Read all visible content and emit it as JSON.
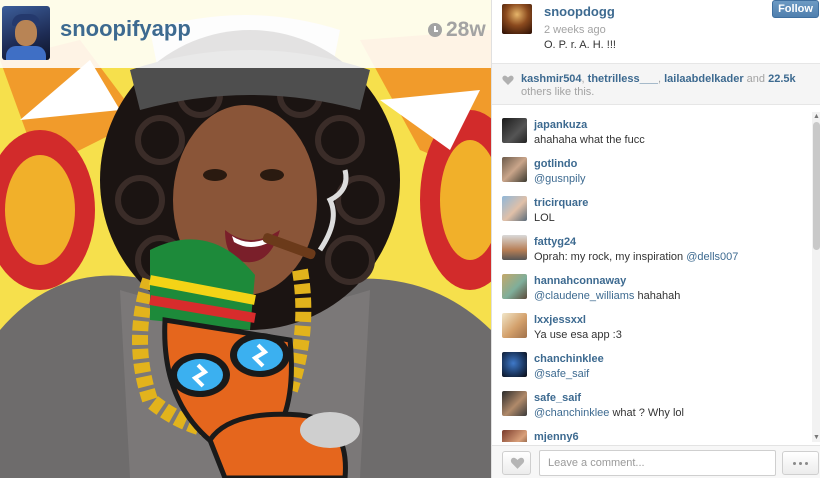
{
  "photo": {
    "username": "snoopifyapp",
    "time": "28w"
  },
  "panel": {
    "owner": "snoopdogg",
    "posted": "2 weeks ago",
    "caption": "O. P. r. A. H. !!!",
    "follow_label": "Follow",
    "likes": {
      "users": [
        "kashmir504",
        "thetrilless___",
        "lailaabdelkader"
      ],
      "sep1": ", ",
      "sep2": ", ",
      "suffix_and": " and ",
      "count": "22.5k",
      "suffix": " others like this."
    },
    "comments": [
      {
        "user": "japankuza",
        "text": "ahahaha what the fucc",
        "mention": "",
        "after": ""
      },
      {
        "user": "gotlindo",
        "text": "",
        "mention": "@gusnpily",
        "after": ""
      },
      {
        "user": "tricirquare",
        "text": "LOL",
        "mention": "",
        "after": ""
      },
      {
        "user": "fattyg24",
        "text": "Oprah: my rock, my inspiration ",
        "mention": "@dells007",
        "after": ""
      },
      {
        "user": "hannahconnaway",
        "text": "",
        "mention": "@claudene_williams",
        "after": " hahahah"
      },
      {
        "user": "lxxjessxxl",
        "text": "Ya use esa app :3",
        "mention": "",
        "after": ""
      },
      {
        "user": "chanchinklee",
        "text": "",
        "mention": "@safe_saif",
        "after": ""
      },
      {
        "user": "safe_saif",
        "text": "",
        "mention": "@chanchinklee",
        "after": " what ? Why lol"
      },
      {
        "user": "mjenny6",
        "text": "",
        "mention": "",
        "after": ""
      }
    ],
    "input_placeholder": "Leave a comment..."
  },
  "colors": {
    "link": "#3d6a90",
    "muted": "#a3a3a3",
    "follow": "#5a88b8"
  },
  "icons": [
    "clock-icon",
    "heart-icon",
    "like-heart-icon",
    "more-dots-icon"
  ]
}
